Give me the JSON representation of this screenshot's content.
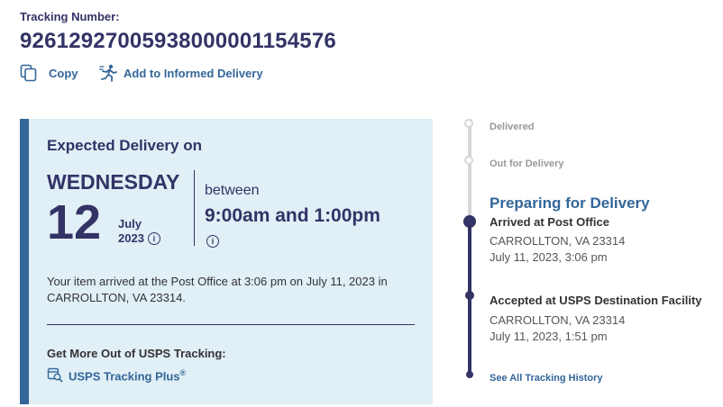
{
  "tracking": {
    "label": "Tracking Number:",
    "number": "9261292700593800000115457​6",
    "copy_label": "Copy",
    "informed_label": "Add to Informed Delivery"
  },
  "card": {
    "title": "Expected Delivery on",
    "day_name": "WEDNESDAY",
    "day_number": "12",
    "month": "July",
    "year": "2023",
    "between": "between",
    "time_window": "9:00am and 1:00pm",
    "status_text": "Your item arrived at the Post Office at 3:06 pm on July 11, 2023 in CARROLLTON, VA 23314.",
    "more_title": "Get More Out of USPS Tracking:",
    "tracking_plus": "USPS Tracking Plus",
    "tracking_plus_mark": "®"
  },
  "timeline": {
    "delivered": "Delivered",
    "out_for_delivery": "Out for Delivery",
    "current_heading": "Preparing for Delivery",
    "events": [
      {
        "title": "Arrived at Post Office",
        "location": "CARROLLTON, VA 23314",
        "datetime": "July 11, 2023, 3:06 pm"
      },
      {
        "title": "Accepted at USPS Destination Facility",
        "location": "CARROLLTON, VA 23314",
        "datetime": "July 11, 2023, 1:51 pm"
      }
    ],
    "history_link": "See All Tracking History"
  },
  "icons": {
    "copy": "copy-icon",
    "informed": "running-person-icon",
    "info": "info-icon",
    "tracking_plus": "tracking-calendar-icon"
  },
  "colors": {
    "navy": "#333366",
    "link_blue": "#336699",
    "card_bg": "#E1EFF6",
    "timeline_grey": "#d7d7d7"
  }
}
